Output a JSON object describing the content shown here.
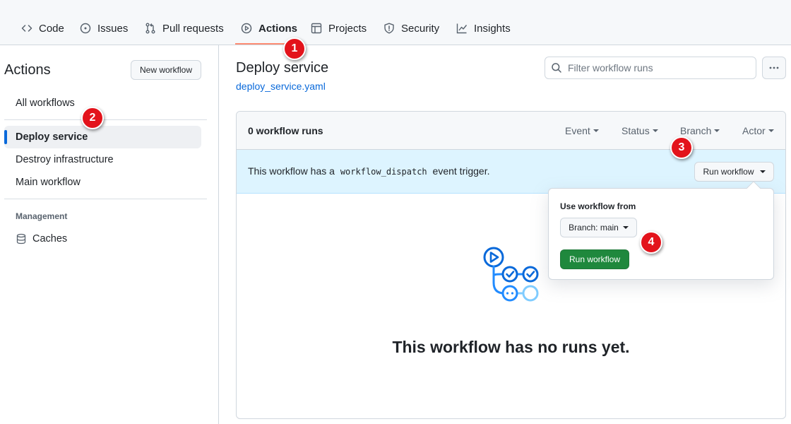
{
  "nav": {
    "tabs": [
      {
        "label": "Code",
        "icon": "code-icon"
      },
      {
        "label": "Issues",
        "icon": "issue-icon"
      },
      {
        "label": "Pull requests",
        "icon": "pull-request-icon"
      },
      {
        "label": "Actions",
        "icon": "play-icon",
        "active": true
      },
      {
        "label": "Projects",
        "icon": "table-icon"
      },
      {
        "label": "Security",
        "icon": "shield-icon"
      },
      {
        "label": "Insights",
        "icon": "graph-icon"
      }
    ]
  },
  "sidebar": {
    "title": "Actions",
    "new_workflow_label": "New workflow",
    "items": [
      {
        "label": "All workflows"
      },
      {
        "label": "Deploy service",
        "active": true
      },
      {
        "label": "Destroy infrastructure"
      },
      {
        "label": "Main workflow"
      }
    ],
    "section_label": "Management",
    "caches_label": "Caches"
  },
  "main": {
    "title": "Deploy service",
    "file_link": "deploy_service.yaml",
    "filter_placeholder": "Filter workflow runs",
    "runs_count": "0 workflow runs",
    "filters": [
      "Event",
      "Status",
      "Branch",
      "Actor"
    ],
    "dispatch": {
      "prefix": "This workflow has a",
      "code": "workflow_dispatch",
      "suffix": "event trigger."
    },
    "run_workflow_label": "Run workflow",
    "empty_title": "This workflow has no runs yet."
  },
  "popover": {
    "label": "Use workflow from",
    "branch_label": "Branch: main",
    "run_label": "Run workflow"
  },
  "annotations": [
    "1",
    "2",
    "3",
    "4"
  ],
  "colors": {
    "accent_blue": "#0969da",
    "tab_underline": "#fd8c73",
    "primary_green": "#1f883d",
    "info_background": "#ddf4ff",
    "annotation_red": "#e3131b"
  }
}
